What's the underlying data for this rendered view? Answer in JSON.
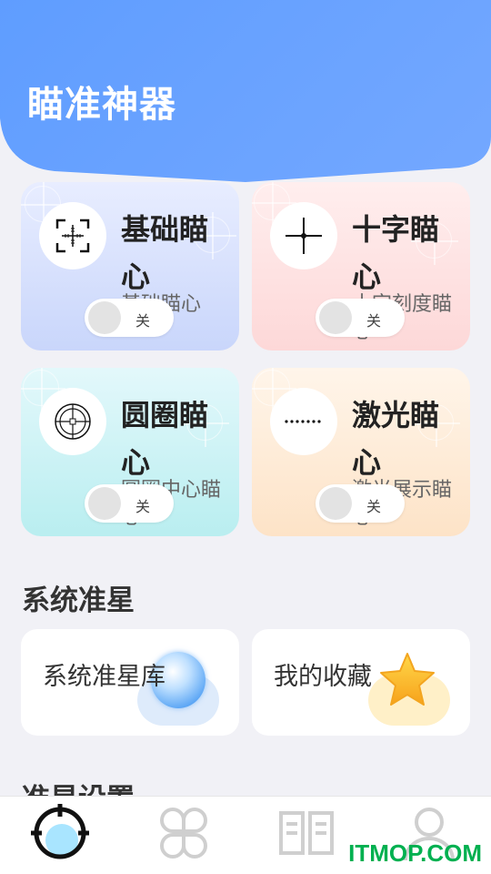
{
  "app": {
    "title": "瞄准神器"
  },
  "crosshairs": [
    {
      "title": "基础瞄心",
      "subtitle": "基础瞄心",
      "toggle_label": "关",
      "icon": "bracket-crosshair-icon"
    },
    {
      "title": "十字瞄心",
      "subtitle": "十字刻度瞄心",
      "toggle_label": "关",
      "icon": "cross-crosshair-icon"
    },
    {
      "title": "圆圈瞄心",
      "subtitle": "圆圈中心瞄心",
      "toggle_label": "关",
      "icon": "circle-crosshair-icon"
    },
    {
      "title": "激光瞄心",
      "subtitle": "激光展示瞄心",
      "toggle_label": "关",
      "icon": "laser-dots-icon"
    }
  ],
  "sections": {
    "system": {
      "title": "系统准星",
      "items": [
        {
          "label": "系统准星库",
          "icon": "lens-icon",
          "accent": "#d8e8fb"
        },
        {
          "label": "我的收藏",
          "icon": "star-icon",
          "accent": "#fff0c8"
        }
      ]
    },
    "settings": {
      "title": "准星设置"
    }
  },
  "tabbar": {
    "active_color": "#9fe3ff",
    "tabs": [
      {
        "icon": "crosshair-tab-icon"
      },
      {
        "icon": "grid-tab-icon"
      },
      {
        "icon": "book-tab-icon"
      },
      {
        "icon": "user-tab-icon"
      }
    ]
  },
  "watermark": {
    "text": "ITMOP.COM"
  }
}
